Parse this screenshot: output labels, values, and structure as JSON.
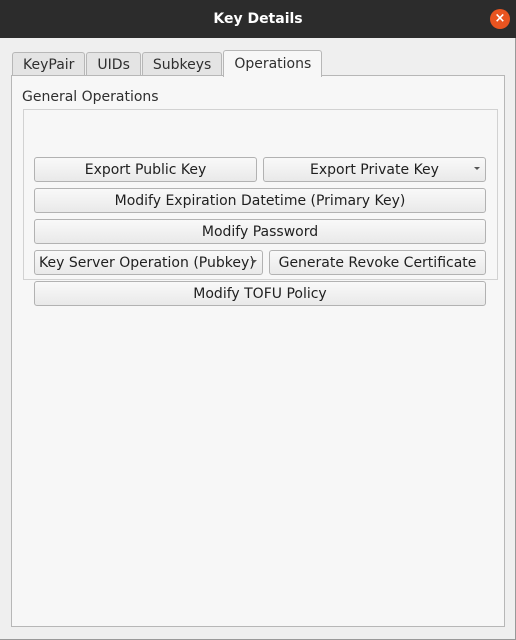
{
  "window": {
    "title": "Key Details",
    "close_icon": "×"
  },
  "tabs": [
    {
      "label": "KeyPair"
    },
    {
      "label": "UIDs"
    },
    {
      "label": "Subkeys"
    },
    {
      "label": "Operations",
      "active": true
    }
  ],
  "general_operations": {
    "title": "General Operations",
    "export_public_key": "Export Public Key",
    "export_private_key": "Export Private Key",
    "modify_expiration": "Modify Expiration Datetime (Primary Key)",
    "modify_password": "Modify Password",
    "key_server_operation": "Key Server Operation (Pubkey)",
    "generate_revoke_certificate": "Generate Revoke Certificate",
    "modify_tofu_policy": "Modify TOFU Policy"
  },
  "colors": {
    "titlebar": "#2c2c2c",
    "close_button": "#e95420"
  }
}
